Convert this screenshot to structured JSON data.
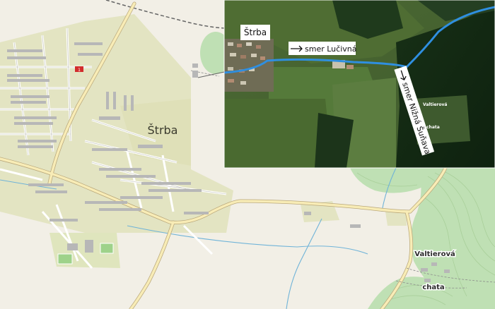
{
  "map": {
    "town_label": "Štrba",
    "chata_title": "Valtierová",
    "chata_subtitle": "chata",
    "road_marker": "1"
  },
  "inset": {
    "town_label": "Štrba",
    "direction_east": "smer Lučivná",
    "direction_south": "smer Nižná Šuňava",
    "chata_title": "Valtierová",
    "chata_subtitle": "chata",
    "route_color": "#2f8fe0"
  }
}
